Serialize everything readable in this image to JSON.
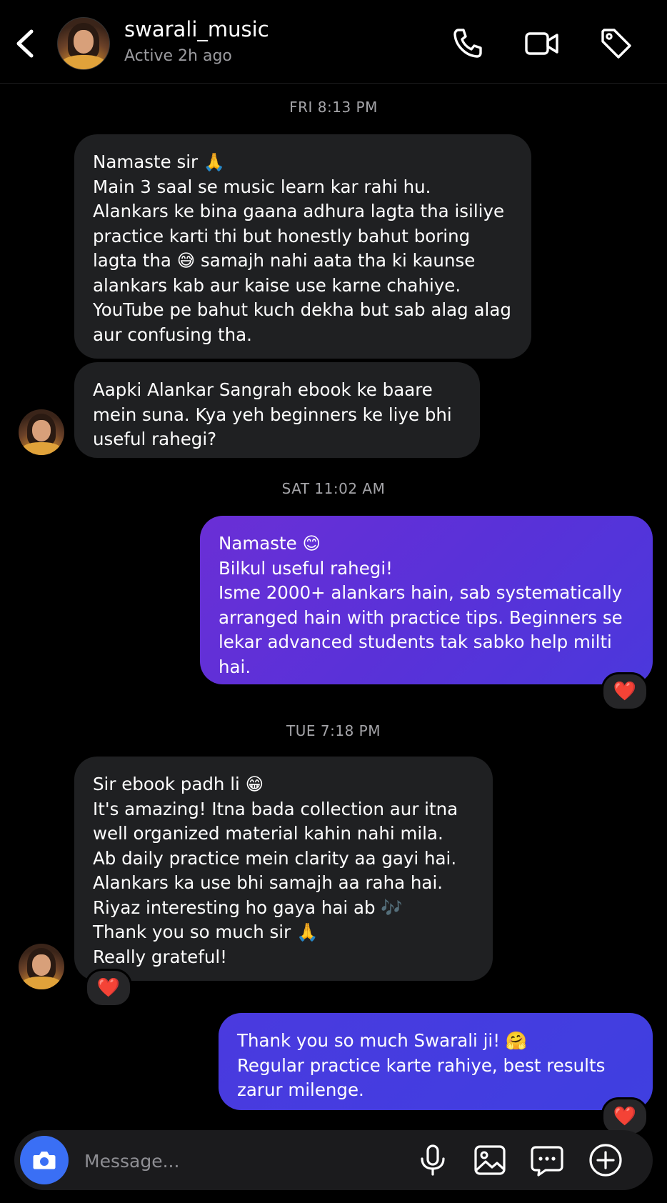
{
  "header": {
    "username": "swarali_music",
    "status": "Active 2h ago",
    "icons": [
      "back-chevron-icon",
      "avatar",
      "phone-icon",
      "video-camera-icon",
      "tag-icon"
    ]
  },
  "timestamps": [
    "FRI 8:13 PM",
    "SAT 11:02 AM",
    "TUE 7:18 PM"
  ],
  "messages": [
    {
      "from": "swarali_music",
      "text": "Namaste sir 🙏\nMain 3 saal se music learn kar rahi hu.\nAlankars ke bina gaana adhura lagta tha isiliye practice karti thi but honestly bahut boring lagta tha 😅 samajh nahi aata tha ki kaunse alankars kab aur kaise use karne chahiye.\nYouTube pe bahut kuch dekha but sab alag alag aur confusing tha."
    },
    {
      "from": "swarali_music",
      "text": "Aapki Alankar Sangrah ebook ke baare mein suna. Kya yeh beginners ke liye bhi useful rahegi?"
    },
    {
      "from": "me",
      "text": "Namaste 😊\nBilkul useful rahegi!\nIsme 2000+ alankars hain, sab systematically arranged hain with practice tips. Beginners se lekar advanced students tak sabko help milti hai.",
      "reaction": "❤️"
    },
    {
      "from": "swarali_music",
      "text": "Sir ebook padh li 😁\nIt's amazing! Itna bada collection aur itna well organized material kahin nahi mila.\nAb daily practice mein clarity aa gayi hai.\nAlankars ka use bhi samajh aa raha hai.\nRiyaz interesting ho gaya hai ab 🎶\nThank you so much sir 🙏\nReally grateful!",
      "reaction": "❤️"
    },
    {
      "from": "me",
      "text": "Thank you so much Swarali ji! 🤗\nRegular practice karte rahiye, best results zarur milenge.",
      "reaction": "❤️"
    }
  ],
  "composer": {
    "placeholder": "Message...",
    "icons": [
      "camera-icon",
      "microphone-icon",
      "image-icon",
      "sticker-chat-icon",
      "plus-icon"
    ]
  },
  "colors": {
    "background": "#000000",
    "received_bubble": "#1f2022",
    "sent_bubble_top": "#6a2fd6",
    "sent_bubble_bottom": "#3f3fe0",
    "camera_button": "#3a6ff5"
  }
}
